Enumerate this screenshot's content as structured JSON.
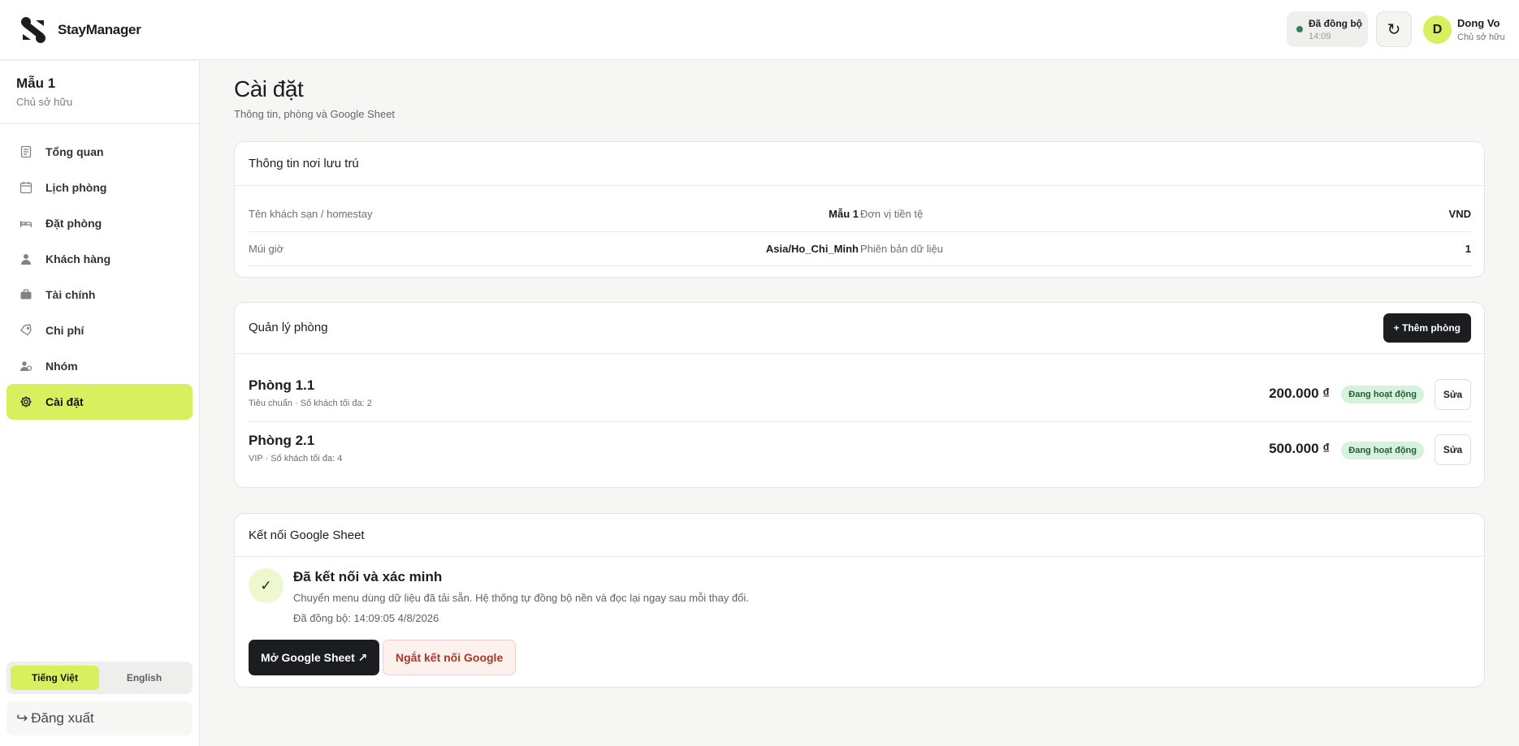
{
  "header": {
    "brand": "StayManager",
    "sync_status": "Đã đồng bộ",
    "sync_time": "14:09",
    "refresh_icon": "↻",
    "user_initial": "D",
    "user_name": "Dong Vo",
    "user_role": "Chủ sở hữu"
  },
  "sidebar": {
    "property_name": "Mẫu 1",
    "property_role": "Chủ sở hữu",
    "items": [
      {
        "label": "Tổng quan",
        "icon": "document-icon"
      },
      {
        "label": "Lịch phòng",
        "icon": "calendar-icon"
      },
      {
        "label": "Đặt phòng",
        "icon": "bed-icon"
      },
      {
        "label": "Khách hàng",
        "icon": "person-icon"
      },
      {
        "label": "Tài chính",
        "icon": "briefcase-icon"
      },
      {
        "label": "Chi phí",
        "icon": "tag-icon"
      },
      {
        "label": "Nhóm",
        "icon": "team-icon"
      },
      {
        "label": "Cài đặt",
        "icon": "gear-icon",
        "active": true
      }
    ],
    "languages": [
      "Tiếng Việt",
      "English"
    ],
    "active_language": "Tiếng Việt",
    "logout_icon": "↪",
    "logout_label": "Đăng xuất"
  },
  "page": {
    "title": "Cài đặt",
    "subtitle": "Thông tin, phòng và Google Sheet"
  },
  "property_info": {
    "title": "Thông tin nơi lưu trú",
    "fields": [
      {
        "label": "Tên khách sạn / homestay",
        "value": "Mẫu 1"
      },
      {
        "label": "Đơn vị tiền tệ",
        "value": "VND"
      },
      {
        "label": "Múi giờ",
        "value": "Asia/Ho_Chi_Minh"
      },
      {
        "label": "Phiên bản dữ liệu",
        "value": "1"
      }
    ]
  },
  "rooms": {
    "title": "Quản lý phòng",
    "add_label": "+ Thêm phòng",
    "list": [
      {
        "name": "Phòng 1.1",
        "meta": "Tiêu chuẩn · Số khách tối đa: 2",
        "price": "200.000 ₫",
        "status": "Đang hoạt động",
        "edit": "Sửa"
      },
      {
        "name": "Phòng 2.1",
        "meta": "VIP · Số khách tối đa: 4",
        "price": "500.000 ₫",
        "status": "Đang hoạt động",
        "edit": "Sửa"
      }
    ]
  },
  "google_sheet": {
    "title": "Kết nối Google Sheet",
    "check_icon": "✓",
    "status_title": "Đã kết nối và xác minh",
    "description": "Chuyển menu dùng dữ liệu đã tải sẵn. Hệ thống tự đồng bộ nền và đọc lại ngay sau mỗi thay đổi.",
    "last_sync": "Đã đồng bộ: 14:09:05 4/8/2026",
    "open_label": "Mở Google Sheet ↗",
    "disconnect_label": "Ngắt kết nối Google"
  },
  "colors": {
    "accent": "#d9f05e",
    "dark": "#1b1d20",
    "success_bg": "#d6f2dc",
    "danger": "#a53a2a"
  }
}
